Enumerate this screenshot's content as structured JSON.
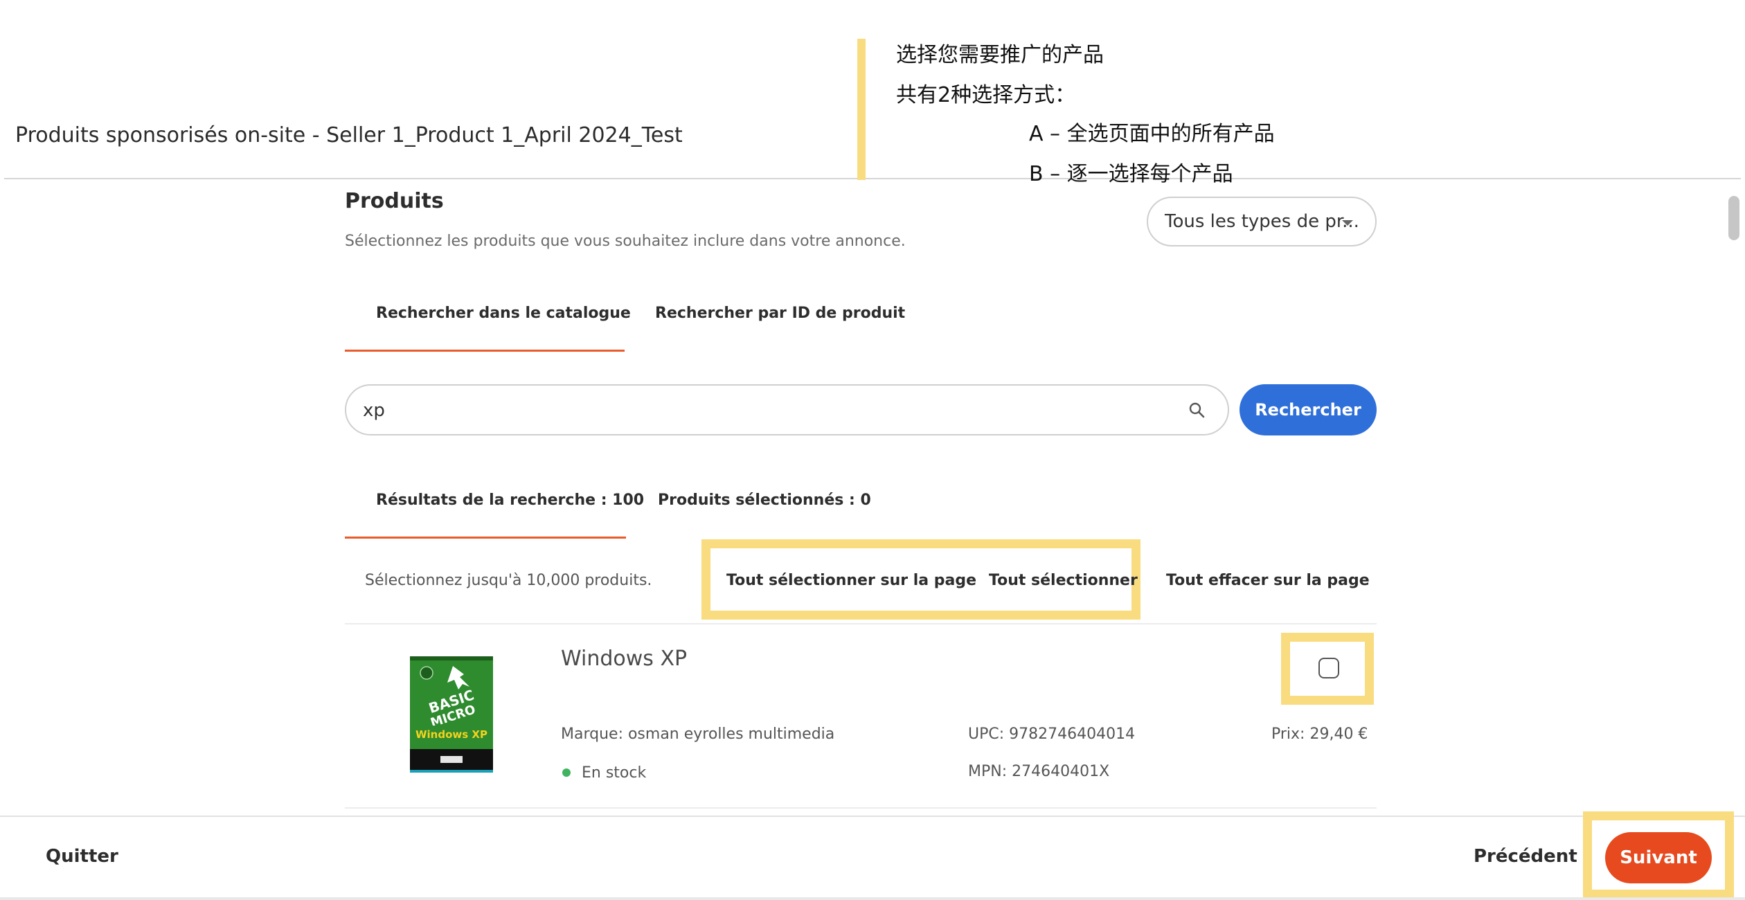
{
  "header": {
    "title": "Produits sponsorisés on-site - Seller 1_Product 1_April 2024_Test"
  },
  "annotation": {
    "lines": [
      "选择您需要推广的产品",
      "共有2种选择方式：",
      "A – 全选页面中的所有产品",
      "B – 逐一选择每个产品"
    ],
    "highlight_color": "#f9dc80"
  },
  "products_section": {
    "title": "Produits",
    "description": "Sélectionnez les produits que vous souhaitez inclure dans votre annonce.",
    "type_filter": {
      "selected": "Tous les types de pr..."
    }
  },
  "search_tabs": [
    {
      "label": "Rechercher dans le catalogue",
      "active": true
    },
    {
      "label": "Rechercher par ID de produit",
      "active": false
    }
  ],
  "search": {
    "value": "xp",
    "button_label": "Rechercher"
  },
  "result_tabs": [
    {
      "label": "Résultats de la recherche : 100",
      "active": true
    },
    {
      "label": "Produits sélectionnés : 0",
      "active": false
    }
  ],
  "selection_bar": {
    "limit_text": "Sélectionnez jusqu'à 10,000 produits.",
    "select_page_label": "Tout sélectionner sur la page",
    "select_all_label": "Tout sélectionner",
    "clear_page_label": "Tout effacer sur la page"
  },
  "products": [
    {
      "name": "Windows XP",
      "brand": "Marque: osman eyrolles multimedia",
      "stock": "En stock",
      "upc": "UPC: 9782746404014",
      "mpn": "MPN: 274640401X",
      "price": "Prix: 29,40 €",
      "selected": false,
      "cover_text": [
        "BASIC",
        "MICRO",
        "Windows XP"
      ]
    }
  ],
  "footer": {
    "quit_label": "Quitter",
    "previous_label": "Précédent",
    "next_label": "Suivant"
  },
  "colors": {
    "accent_orange": "#ea5a2b",
    "primary_blue": "#2f6fd9",
    "next_button": "#e64a1e",
    "stock_green": "#3fb35f"
  }
}
